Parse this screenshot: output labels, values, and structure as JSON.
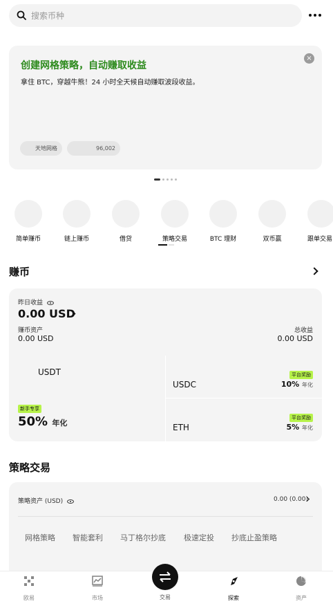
{
  "search": {
    "placeholder": "搜索币种",
    "more_icon": "more-dots-icon"
  },
  "promo": {
    "title": "创建网格策略，自动赚取收益",
    "subtitle": "拿住 BTC，穿越牛熊！24 小时全天候自动赚取波段收益。",
    "chip1": "天地网格",
    "chip2": "96,002",
    "close_icon": "close-icon",
    "close_glyph": "×"
  },
  "carousel": {
    "count": 5,
    "active_index": 0
  },
  "categories": [
    {
      "label": "简单赚币"
    },
    {
      "label": "链上赚币"
    },
    {
      "label": "借贷"
    },
    {
      "label": "策略交易"
    },
    {
      "label": "BTC 理财"
    },
    {
      "label": "双币赢"
    },
    {
      "label": "跟单交易"
    }
  ],
  "earn": {
    "title": "赚币",
    "yesterday_label": "昨日收益",
    "yesterday_value": "0.00 USD",
    "assets_label": "赚币资产",
    "assets_value": "0.00 USD",
    "total_label": "总收益",
    "total_value": "0.00 USD",
    "products": {
      "usdt": {
        "coin": "USDT",
        "badge": "新手专享",
        "rate": "50%",
        "unit": "年化"
      },
      "usdc": {
        "coin": "USDC",
        "badge": "平台奖励",
        "rate": "10%",
        "unit": "年化"
      },
      "eth": {
        "coin": "ETH",
        "badge": "平台奖励",
        "rate": "5%",
        "unit": "年化"
      }
    }
  },
  "strategy": {
    "title": "策略交易",
    "assets_label": "策略资产 (USD)",
    "assets_value": "0.00 (0.00)",
    "tabs": [
      "网格策略",
      "智能套利",
      "马丁格尔抄底",
      "极速定投",
      "抄底止盈策略"
    ]
  },
  "nav": {
    "items": [
      "欧易",
      "市场",
      "交易",
      "探索",
      "资产"
    ],
    "active": "探索",
    "icons": [
      "home-icon",
      "market-chart-icon",
      "trade-swap-icon",
      "explore-compass-icon",
      "assets-pie-icon"
    ]
  },
  "colors": {
    "accent_green": "#2e8b1e",
    "badge_green": "#b7f34a"
  }
}
